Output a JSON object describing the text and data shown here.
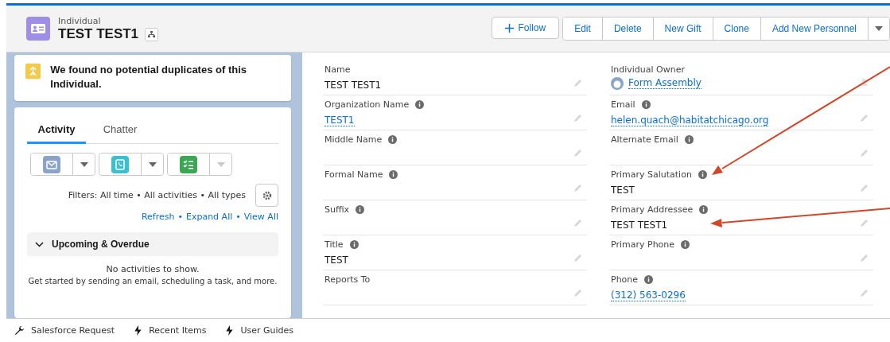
{
  "header": {
    "object_type": "Individual",
    "title": "TEST TEST1",
    "follow": "Follow",
    "actions": [
      "Edit",
      "Delete",
      "New Gift",
      "Clone",
      "Add New Personnel"
    ]
  },
  "duplicates": {
    "message": "We found no potential duplicates of this Individual."
  },
  "activity": {
    "tabs": [
      {
        "label": "Activity",
        "selected": true
      },
      {
        "label": "Chatter",
        "selected": false
      }
    ],
    "composers": [
      {
        "kind": "email",
        "disabled": false
      },
      {
        "kind": "call",
        "disabled": false
      },
      {
        "kind": "task",
        "disabled": true
      }
    ],
    "filters": "Filters: All time • All activities • All types",
    "links": [
      "Refresh",
      "Expand All",
      "View All"
    ],
    "link_separator": "•",
    "section": {
      "title": "Upcoming & Overdue",
      "expanded": true
    },
    "empty_title": "No activities to show.",
    "empty_text": "Get started by sending an email, scheduling a task, and more."
  },
  "fields_left": [
    {
      "label": "Name",
      "info": false,
      "value": "TEST TEST1",
      "link": false
    },
    {
      "label": "Organization Name",
      "info": true,
      "value": "TEST1",
      "link": true
    },
    {
      "label": "Middle Name",
      "info": true
    },
    {
      "label": "Formal Name",
      "info": true
    },
    {
      "label": "Suffix",
      "info": true
    },
    {
      "label": "Title",
      "info": true,
      "value": "TEST",
      "link": false
    },
    {
      "label": "Reports To",
      "info": false
    }
  ],
  "fields_right": [
    {
      "label": "Individual Owner",
      "info": false,
      "value": "Form Assembly",
      "link": true,
      "kind": "owner"
    },
    {
      "label": "Email",
      "info": true,
      "value": "helen.quach@habitatchicago.org",
      "link": true
    },
    {
      "label": "Alternate Email",
      "info": true
    },
    {
      "label": "Primary Salutation",
      "info": true,
      "value": "TEST",
      "link": false
    },
    {
      "label": "Primary Addressee",
      "info": true,
      "value": "TEST TEST1",
      "link": false
    },
    {
      "label": "Primary Phone",
      "info": true
    },
    {
      "label": "Phone",
      "info": true,
      "value": "(312) 563-0296",
      "link": true
    }
  ],
  "utility_bar": [
    {
      "label": "Salesforce Request",
      "kind": "wrench"
    },
    {
      "label": "Recent Items",
      "kind": "bolt"
    },
    {
      "label": "User Guides",
      "kind": "bolt"
    }
  ]
}
